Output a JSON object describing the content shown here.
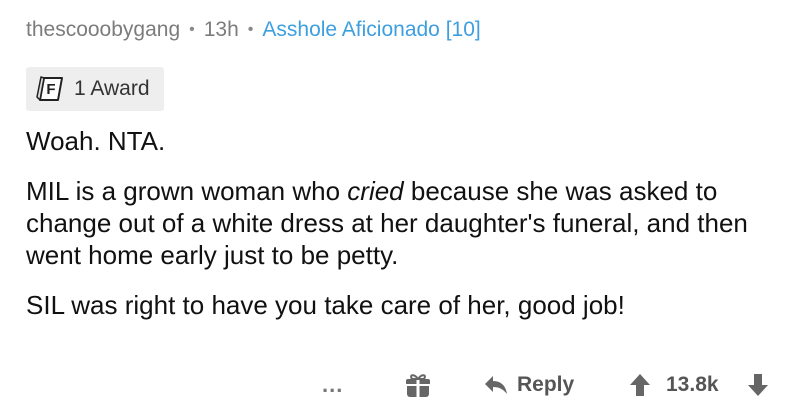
{
  "comment": {
    "username": "thescooobygang",
    "time": "13h",
    "flair": "Asshole Aficionado [10]",
    "award": {
      "icon": "f-award-icon",
      "label": "1 Award"
    },
    "body": {
      "p1": "Woah. NTA.",
      "p2_before": "MIL is a grown woman who ",
      "p2_em": "cried",
      "p2_after": " because she was asked to change out of a white dress at her daughter's funeral, and then went home early just to be petty.",
      "p3": "SIL was right to have you take care of her, good job!"
    }
  },
  "actions": {
    "more_label": "...",
    "reply_label": "Reply",
    "score": "13.8k"
  },
  "colors": {
    "flair": "#3d9fe0",
    "meta": "#7c7c7c",
    "pill_bg": "#eeeeee"
  }
}
